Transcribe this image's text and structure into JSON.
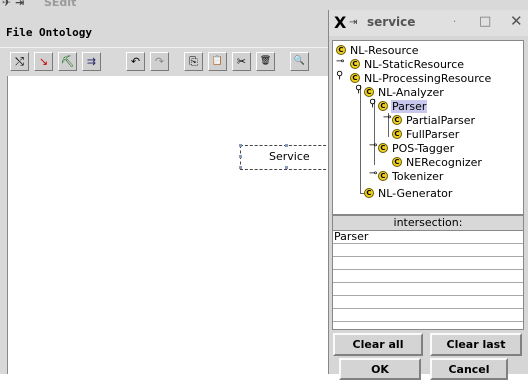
{
  "main_window": {
    "title_glyphs": "✈ ⇥",
    "title": "SEdit",
    "menu": [
      "File",
      "Ontology"
    ],
    "toolbar_icons": [
      {
        "name": "connect-tool-icon",
        "glyph": "⤭"
      },
      {
        "name": "select-tool-icon",
        "glyph": "↘"
      },
      {
        "name": "brush-tool-icon",
        "glyph": "⛏"
      },
      {
        "name": "arrow-tool-icon",
        "glyph": "⇉"
      },
      {
        "name": "undo-icon",
        "glyph": "↶"
      },
      {
        "name": "redo-icon",
        "glyph": "↷"
      },
      {
        "name": "copy-icon",
        "glyph": "⎘"
      },
      {
        "name": "paste-icon",
        "glyph": "📋"
      },
      {
        "name": "cut-icon",
        "glyph": "✂"
      },
      {
        "name": "delete-icon",
        "glyph": "🗑"
      },
      {
        "name": "zoom-icon",
        "glyph": "🔍"
      }
    ],
    "canvas_node_label": "Service"
  },
  "dialog": {
    "title_logo": "X",
    "pin_glyph": "⇥",
    "title": "service",
    "title_dot": "·",
    "min_glyph": "□",
    "max_glyph": "□",
    "close_glyph": "✕",
    "tree": [
      {
        "label": "NL-Resource",
        "selected": false
      },
      {
        "label": "NL-StaticResource",
        "selected": false
      },
      {
        "label": "NL-ProcessingResource",
        "selected": false
      },
      {
        "label": "NL-Analyzer",
        "selected": false
      },
      {
        "label": "Parser",
        "selected": true
      },
      {
        "label": "PartialParser",
        "selected": false
      },
      {
        "label": "FullParser",
        "selected": false
      },
      {
        "label": "POS-Tagger",
        "selected": false
      },
      {
        "label": "NERecognizer",
        "selected": false
      },
      {
        "label": "Tokenizer",
        "selected": false
      },
      {
        "label": "NL-Generator",
        "selected": false
      }
    ],
    "class_icon_letter": "C",
    "intersection_header": "intersection:",
    "intersection_items": [
      "Parser"
    ],
    "buttons": {
      "clear_all": "Clear all",
      "clear_last": "Clear last",
      "ok": "OK",
      "cancel": "Cancel"
    }
  },
  "colors": {
    "window_bg": "#d9d9d9",
    "class_icon": "#f0d020",
    "selection": "#c8c8ee"
  }
}
